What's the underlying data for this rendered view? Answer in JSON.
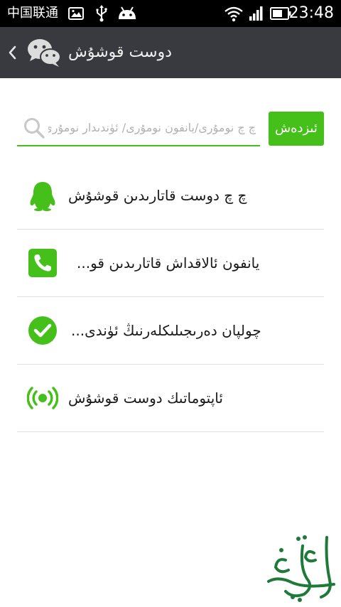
{
  "status_bar": {
    "carrier": "中国联通",
    "time": "23:48",
    "icons": [
      "image-icon",
      "usb-icon",
      "android-icon",
      "wifi-icon",
      "signal-icon",
      "battery-icon"
    ]
  },
  "app_bar": {
    "title": "دوست قوشۇش",
    "icons": [
      "back-chevron-icon",
      "wechat-logo-icon"
    ]
  },
  "search": {
    "placeholder": "چ چ نومۇرى/يانفون نومۇرى/ ئۈندىدار نومۇرى",
    "button_label": "ئىزدەش"
  },
  "menu": {
    "items": [
      {
        "label": "چ چ دوست قاتارىدىن قوشۇش",
        "icon": "qq-penguin-icon"
      },
      {
        "label": "يانفون ئالاقداش قاتارىدىن قو...",
        "icon": "phone-icon"
      },
      {
        "label": "چولپان دەرىجىلىكلەرنىڭ ئۈندى...",
        "icon": "check-circle-icon"
      },
      {
        "label": "ئاپتوماتىك دوست قوشۇش",
        "icon": "radar-icon"
      }
    ]
  },
  "colors": {
    "accent": "#45c01a",
    "app_bar": "#393a3f",
    "status_bar": "#000000",
    "divider": "#e0e0e0",
    "watermark": "#1f7a3a"
  }
}
